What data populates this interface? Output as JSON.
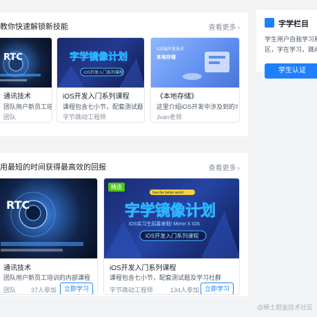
{
  "colors": {
    "accent": "#1e80ff",
    "badge": "#52c41a",
    "text": "#1d2129",
    "muted": "#86909c"
  },
  "section1": {
    "title": "教你快速解锁新技能",
    "see_more": "查看更多",
    "cards": [
      {
        "title": "通讯技术",
        "desc": "团队用户新员工培训",
        "author": "团队",
        "thumb_text": "RTC"
      },
      {
        "title": "iOS开发入门系列课程",
        "desc": "课程包含七小节，配套测试题及",
        "author": "字节跳动工程师",
        "thumb_text": "字学镜像计划",
        "thumb_sub": "iOS开发入门系列课程"
      },
      {
        "title": "《本地存储》",
        "desc": "这里介绍iOS开发中涉及到的本地",
        "author": "Jvan老师",
        "thumb_text": "iOS端开发技术",
        "thumb_sub": "本地存储"
      }
    ]
  },
  "section2": {
    "title": "用最短的时间获得最高效的回报",
    "see_more": "查看更多",
    "cards": [
      {
        "title": "通讯技术",
        "desc": "团队用户新员工培训的内部课程",
        "author": "团队",
        "count": "37人参加",
        "button": "立即学习",
        "thumb_text": "RTC"
      },
      {
        "badge": "精选",
        "title": "iOS开发入门系列课程",
        "desc": "课程包含七小节，配套测试题及学习社群",
        "author": "字节跳动工程师",
        "count": "134人参加",
        "button": "立即学习",
        "thumb_text": "字学镜像计划",
        "thumb_top": "See the better world",
        "thumb_mid": "iOS实习生招募来啦! Mirror X iOS",
        "thumb_sub": "iOS开发入门系列课程"
      }
    ]
  },
  "sidebar": {
    "title": "字学栏目",
    "desc_line1": "学生用户自我学习和",
    "desc_line2": "区，字在学习，跳动",
    "button": "学生认证"
  },
  "watermark": "@稀土掘金技术社区"
}
